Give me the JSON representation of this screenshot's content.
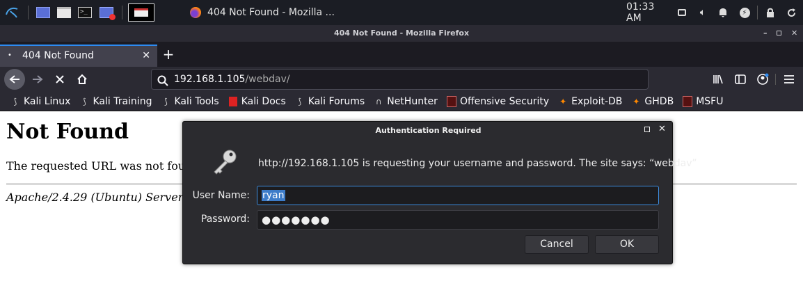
{
  "taskbar": {
    "active_window_title": "404 Not Found - Mozilla ...",
    "clock": "01:33 AM",
    "icons": [
      "kali-menu-icon",
      "workspace-icon",
      "file-manager-icon",
      "terminal-icon",
      "screen-recorder-icon",
      "firefox-icon",
      "volume-icon",
      "bell-icon",
      "power-icon",
      "lock-icon",
      "refresh-icon"
    ]
  },
  "window": {
    "title": "404 Not Found - Mozilla Firefox"
  },
  "tab": {
    "label": "404 Not Found"
  },
  "urlbar": {
    "host": "192.168.1.105",
    "path": "/webdav/"
  },
  "bookmarks": [
    {
      "label": "Kali Linux"
    },
    {
      "label": "Kali Training"
    },
    {
      "label": "Kali Tools"
    },
    {
      "label": "Kali Docs"
    },
    {
      "label": "Kali Forums"
    },
    {
      "label": "NetHunter"
    },
    {
      "label": "Offensive Security"
    },
    {
      "label": "Exploit-DB"
    },
    {
      "label": "GHDB"
    },
    {
      "label": "MSFU"
    }
  ],
  "page": {
    "heading": "Not Found",
    "message": "The requested URL was not fou",
    "address": "Apache/2.4.29 (Ubuntu) Server"
  },
  "dialog": {
    "title": "Authentication Required",
    "prompt": "http://192.168.1.105 is requesting your username and password. The site says: “webdav”",
    "username_label": "User Name:",
    "username_value": "ryan",
    "password_label": "Password:",
    "password_value": "●●●●●●●",
    "cancel_label": "Cancel",
    "ok_label": "OK"
  },
  "colors": {
    "accent": "#2d8bf2",
    "selection": "#3d7cc9"
  }
}
